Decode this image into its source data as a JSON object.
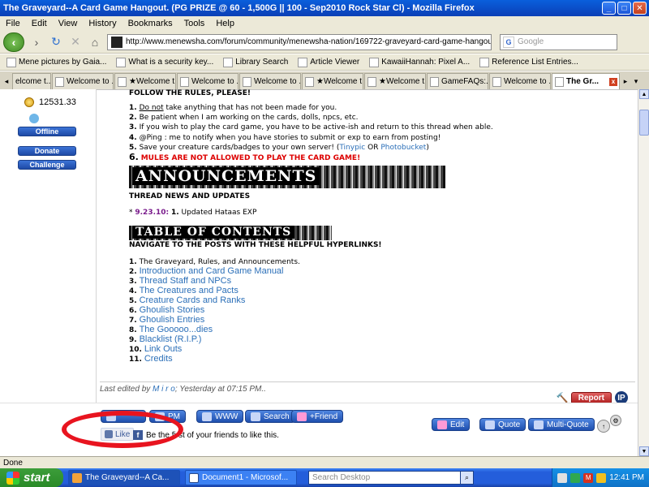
{
  "window": {
    "title": "The Graveyard--A Card Game Hangout. (PG PRIZE @ 60 - 1,500G || 100 - Sep2010 Rock Star Cl) - Mozilla Firefox"
  },
  "menu": [
    "File",
    "Edit",
    "View",
    "History",
    "Bookmarks",
    "Tools",
    "Help"
  ],
  "nav": {
    "url": "http://www.menewsha.com/forum/community/menewsha-nation/169722-graveyard-card-game-hangout-pg-prize",
    "search_placeholder": "Google"
  },
  "bookmarks": [
    "Mene pictures by Gaia...",
    "What is a security key...",
    "Library Search",
    "Article Viewer",
    "KawaiiHannah: Pixel A...",
    "Reference List Entries..."
  ],
  "tabs": [
    "elcome t...",
    "Welcome to ...",
    "★Welcome t...",
    "Welcome to ...",
    "Welcome to ...",
    "★Welcome t...",
    "★Welcome t...",
    "GameFAQs:...",
    "Welcome to ...",
    "The Gr..."
  ],
  "sidebar": {
    "coins": "12531.33",
    "buttons": [
      "Offline",
      "Donate",
      "Challenge"
    ]
  },
  "post": {
    "rules_heading": "FOLLOW THE RULES, PLEASE!",
    "rules": [
      {
        "n": "1.",
        "pre": "",
        "u": "Do not",
        "text": " take anything that has not been made for you."
      },
      {
        "n": "2.",
        "text": "Be patient when I am working on the cards, dolls, npcs, etc."
      },
      {
        "n": "3.",
        "text": "If you wish to play the card game, you have to be active-ish and return to this thread when able."
      },
      {
        "n": "4.",
        "text": "@Ping : me to notify when you have stories to submit or exp to earn from posting!"
      },
      {
        "n": "5.",
        "text": "Save your creature cards/badges to your own server! (",
        "l1": "Tinypic",
        "or": " OR ",
        "l2": "Photobucket",
        "end": ")"
      },
      {
        "n": "6.",
        "text": "MULES ARE NOT ALLOWED TO PLAY THE CARD GAME!"
      }
    ],
    "announcements_banner": "ANNOUNCEMENTS",
    "thread_news": "THREAD NEWS AND UPDATES",
    "update_star": "*",
    "update_date": "9.23.10:",
    "update_num": "1.",
    "update_text": " Updated Hataas EXP",
    "toc_banner": "TABLE OF CONTENTS",
    "toc_heading": "NAVIGATE TO THE POSTS WITH THESE HELPFUL HYPERLINKS!",
    "toc": [
      {
        "n": "1.",
        "text": "The Graveyard, Rules, and Announcements.",
        "link": false
      },
      {
        "n": "2.",
        "text": "Introduction and Card Game Manual",
        "link": true
      },
      {
        "n": "3.",
        "text": "Thread Staff and NPCs",
        "link": true
      },
      {
        "n": "4.",
        "text": "The Creatures and Pacts",
        "link": true
      },
      {
        "n": "5.",
        "text": "Creature Cards and Ranks",
        "link": true
      },
      {
        "n": "6.",
        "text": "Ghoulish Stories",
        "link": true
      },
      {
        "n": "7.",
        "text": "Ghoulish Entries",
        "link": true
      },
      {
        "n": "8.",
        "text": "The Gooooo...dies",
        "link": true
      },
      {
        "n": "9.",
        "text": "Blacklist (R.I.P.)",
        "link": true
      },
      {
        "n": "10.",
        "text": "Link Outs",
        "link": true
      },
      {
        "n": "11.",
        "text": "Credits",
        "link": true
      }
    ],
    "last_edited_prefix": "Last edited by",
    "last_edited_by": "M i r o",
    "last_edited_mid": "; Yesterday at",
    "last_edited_time": "07:15 PM",
    "last_edited_end": ".."
  },
  "actions": {
    "report": "Report",
    "ip": "IP",
    "pm": "PM",
    "www": "WWW",
    "search": "Search",
    "friend": "+Friend",
    "edit": "Edit",
    "quote": "Quote",
    "multiquote": "Multi-Quote"
  },
  "facebook": {
    "like": "Like",
    "text": "Be the first of your friends to like this."
  },
  "status": "Done",
  "taskbar": {
    "start": "start",
    "tasks": [
      "The Graveyard--A Ca...",
      "Document1 - Microsof..."
    ],
    "search_placeholder": "Search Desktop",
    "clock": "12:41 PM"
  }
}
